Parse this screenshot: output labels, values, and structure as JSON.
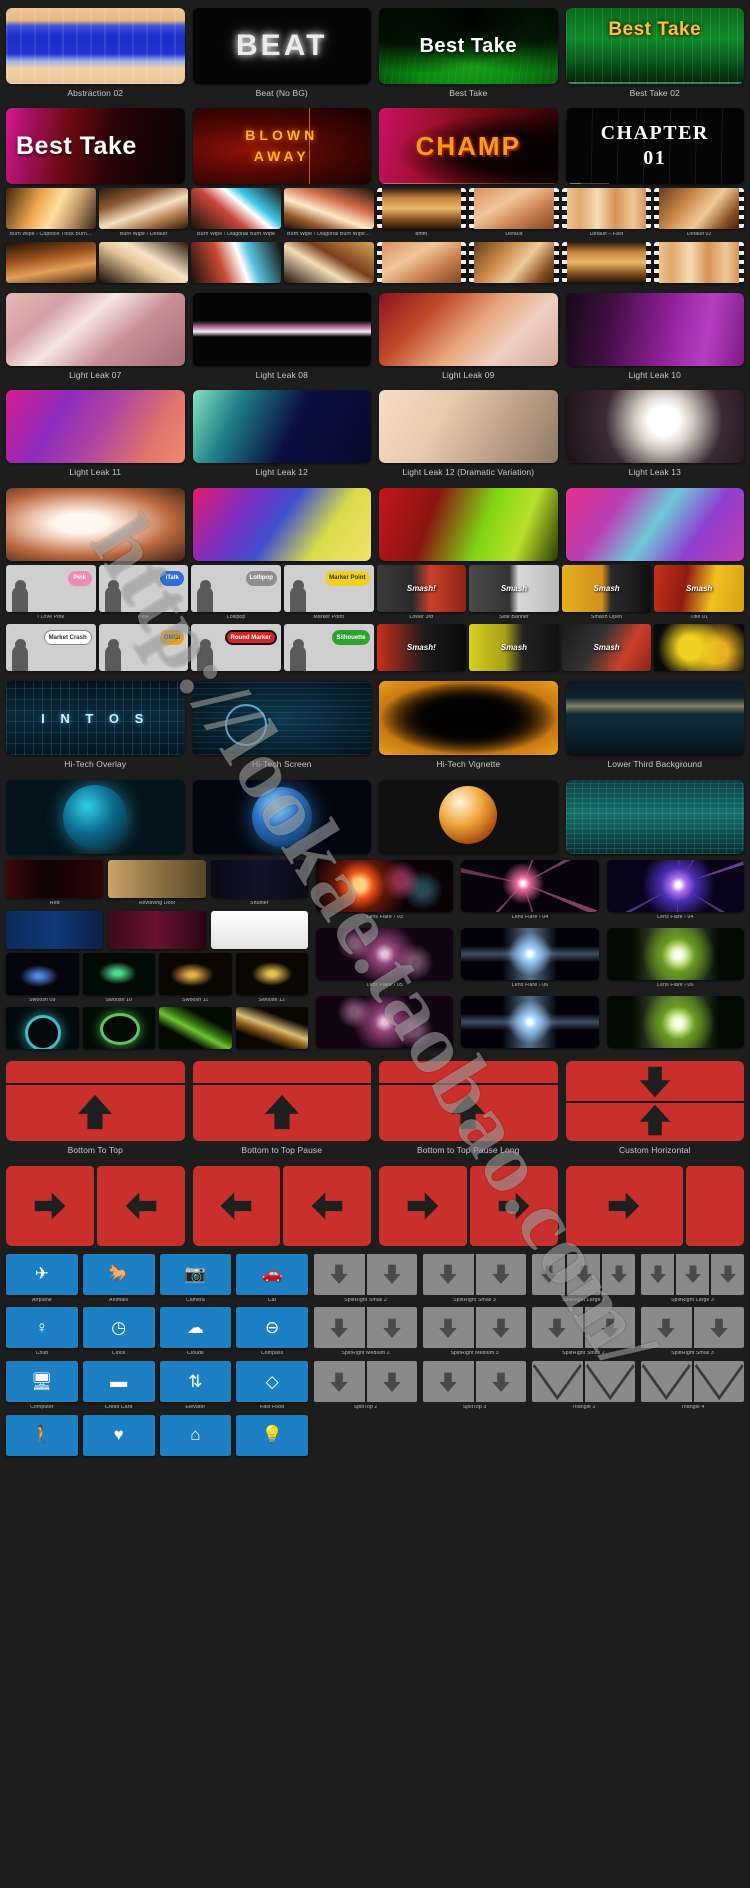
{
  "watermark": "http://lookae.taobao.com/",
  "sections": [
    {
      "id": "titles-row-1",
      "kind": "large",
      "items": [
        {
          "label": "Abstraction 02",
          "art": "abstraction02",
          "text": ""
        },
        {
          "label": "Beat (No BG)",
          "art": "beatbg",
          "text": "BEAT"
        },
        {
          "label": "Best Take",
          "art": "bestgreen",
          "text": "Best Take"
        },
        {
          "label": "Best Take 02",
          "art": "bestgreen2",
          "text": "Best Take"
        }
      ]
    },
    {
      "id": "titles-row-2",
      "kind": "large-nolabel",
      "items": [
        {
          "label": "",
          "art": "besttake1",
          "text": "Best Take"
        },
        {
          "label": "",
          "art": "blown",
          "text": "BLOWN AWAY"
        },
        {
          "label": "",
          "art": "champ",
          "text": "CHAMP"
        },
        {
          "label": "",
          "art": "chapter",
          "text": "CHAPTER 01"
        }
      ]
    },
    {
      "id": "burn-wipes-row-1",
      "kind": "small",
      "items": [
        {
          "label": "Burn Wipe › Capriole Thick Burn…",
          "art": "burn1"
        },
        {
          "label": "Burn Wipe › Default",
          "art": "burn2"
        },
        {
          "label": "Burn Wipe › Diagonal Burn Wipe",
          "art": "burn3"
        },
        {
          "label": "Burn Wipe › Diagonal Burn Wipe…",
          "art": "burn4"
        },
        {
          "label": "8mm",
          "art": "filmA",
          "perf": true
        },
        {
          "label": "Default",
          "art": "filmB",
          "perf": true
        },
        {
          "label": "Default – Fast",
          "art": "filmC",
          "perf": true
        },
        {
          "label": "Default 02",
          "art": "filmD",
          "perf": true
        }
      ]
    },
    {
      "id": "burn-wipes-row-2",
      "kind": "small-nolabel",
      "items": [
        {
          "label": "",
          "art": "burn5"
        },
        {
          "label": "",
          "art": "burn6"
        },
        {
          "label": "",
          "art": "burn7"
        },
        {
          "label": "",
          "art": "burn8"
        },
        {
          "label": "",
          "art": "filmB",
          "perf": true
        },
        {
          "label": "",
          "art": "filmD",
          "perf": true
        },
        {
          "label": "",
          "art": "filmA",
          "perf": true
        },
        {
          "label": "",
          "art": "filmC",
          "perf": true
        }
      ]
    },
    {
      "id": "light-leaks-row-1",
      "kind": "large",
      "items": [
        {
          "label": "Light Leak 07",
          "art": "ll07"
        },
        {
          "label": "Light Leak 08",
          "art": "ll08"
        },
        {
          "label": "Light Leak 09",
          "art": "ll09"
        },
        {
          "label": "Light Leak 10",
          "art": "ll10"
        }
      ]
    },
    {
      "id": "light-leaks-row-2",
      "kind": "large",
      "items": [
        {
          "label": "Light Leak 11",
          "art": "ll11"
        },
        {
          "label": "Light Leak 12",
          "art": "ll12"
        },
        {
          "label": "Light Leak 12 (Dramatic Variation)",
          "art": "ll12d"
        },
        {
          "label": "Light Leak 13",
          "art": "ll13"
        }
      ]
    },
    {
      "id": "light-leaks-row-3",
      "kind": "large-nolabel",
      "items": [
        {
          "label": "",
          "art": "ll14"
        },
        {
          "label": "",
          "art": "ll15"
        },
        {
          "label": "",
          "art": "ll16"
        },
        {
          "label": "",
          "art": "ll17"
        }
      ]
    },
    {
      "id": "lower-thirds-row-1",
      "kind": "small",
      "items": [
        {
          "label": "I Love Pink",
          "art": "silho",
          "bubble": {
            "text": "Pink",
            "style": "pink"
          }
        },
        {
          "label": "iTalk",
          "art": "silho",
          "bubble": {
            "text": "iTalk",
            "style": "blue"
          }
        },
        {
          "label": "Lollipop",
          "art": "silho",
          "bubble": {
            "text": "Lollipop",
            "style": "gray"
          }
        },
        {
          "label": "Marker Point",
          "art": "silho",
          "bubble": {
            "text": "Marker Point",
            "style": "yellow"
          }
        },
        {
          "label": "Lower 3rd",
          "art": "smash1",
          "text": "Smash!"
        },
        {
          "label": "Side Banner",
          "art": "smash2",
          "text": "Smash"
        },
        {
          "label": "Smash Open",
          "art": "smash3",
          "text": "Smash"
        },
        {
          "label": "Title 01",
          "art": "smash4",
          "text": "Smash"
        }
      ]
    },
    {
      "id": "lower-thirds-row-2",
      "kind": "small-nolabel",
      "items": [
        {
          "label": "",
          "art": "silho",
          "bubble": {
            "text": "Market Crash",
            "style": "white"
          }
        },
        {
          "label": "",
          "art": "silho",
          "bubble": {
            "text": "OMG!",
            "style": "orange"
          }
        },
        {
          "label": "",
          "art": "silho",
          "bubble": {
            "text": "Round Marker",
            "style": "red"
          }
        },
        {
          "label": "",
          "art": "silho",
          "bubble": {
            "text": "Silhouette",
            "style": "green"
          }
        },
        {
          "label": "",
          "art": "smash5",
          "text": "Smash!"
        },
        {
          "label": "",
          "art": "smash6",
          "text": "Smash"
        },
        {
          "label": "",
          "art": "smash7",
          "text": "Smash"
        },
        {
          "label": "",
          "art": "smash8",
          "text": ""
        }
      ]
    },
    {
      "id": "hi-tech-row",
      "kind": "large",
      "items": [
        {
          "label": "Hi-Tech Overlay",
          "art": "hitech1",
          "text": "I N T O S"
        },
        {
          "label": "Hi-Tech Screen",
          "art": "hitech2"
        },
        {
          "label": "Hi-Tech Vignette",
          "art": "hitech3"
        },
        {
          "label": "Lower Third Background",
          "art": "hitech4"
        }
      ]
    },
    {
      "id": "globes-row",
      "kind": "large-nolabel",
      "items": [
        {
          "label": "",
          "art": "globe1"
        },
        {
          "label": "",
          "art": "globe2"
        },
        {
          "label": "",
          "art": "globe3"
        },
        {
          "label": "",
          "art": "globe4"
        }
      ]
    },
    {
      "id": "mixed-left-lower-thirds",
      "kind": "mixed",
      "left_items": [
        {
          "label": "Red",
          "art": "lt1"
        },
        {
          "label": "Revolving Door",
          "art": "lt2"
        },
        {
          "label": "Shuffler",
          "art": "lt3"
        },
        {
          "label": "",
          "art": "lt4"
        },
        {
          "label": "",
          "art": "lt5"
        },
        {
          "label": "",
          "art": "lt6"
        }
      ],
      "right_items": [
        {
          "label": "Lens Flare › 03",
          "art": "lf1"
        },
        {
          "label": "Lens Flare › 04",
          "art": "lf2"
        },
        {
          "label": "Lens Flare › 04",
          "art": "lf3"
        },
        {
          "label": "Lens Flare › 05",
          "art": "lf4"
        },
        {
          "label": "Lens Flare › 06",
          "art": "lf5"
        },
        {
          "label": "Lens Flare › 06",
          "art": "lf6"
        }
      ]
    },
    {
      "id": "swooshes-row",
      "kind": "small",
      "items": [
        {
          "label": "Swoosh 09",
          "art": "swoosh1"
        },
        {
          "label": "Swoosh 10",
          "art": "swoosh2"
        },
        {
          "label": "Swoosh 11",
          "art": "swoosh3"
        },
        {
          "label": "Swoosh 12",
          "art": "swoosh4"
        }
      ]
    },
    {
      "id": "rings-row",
      "kind": "small-nolabel",
      "items": [
        {
          "label": "",
          "art": "ring1"
        },
        {
          "label": "",
          "art": "ring2"
        },
        {
          "label": "",
          "art": "ring3"
        },
        {
          "label": "",
          "art": "ring4"
        }
      ]
    },
    {
      "id": "red-transitions-row-1",
      "kind": "red",
      "items": [
        {
          "label": "Bottom To Top",
          "style": "single-up"
        },
        {
          "label": "Bottom to Top Pause",
          "style": "single-up"
        },
        {
          "label": "Bottom to Top Pause Long",
          "style": "single-up"
        },
        {
          "label": "Custom Horizontal",
          "style": "double-vertical"
        }
      ]
    },
    {
      "id": "red-transitions-row-2",
      "kind": "red-nolabel",
      "items": [
        {
          "label": "",
          "style": "split-right-left"
        },
        {
          "label": "",
          "style": "split-left-left"
        },
        {
          "label": "",
          "style": "split-right-right"
        },
        {
          "label": "",
          "style": "split-right-right-2"
        }
      ]
    },
    {
      "id": "blue-icons",
      "columns": 4,
      "rows": [
        [
          {
            "label": "Airplane",
            "icon": "airplane-icon",
            "glyph": "✈"
          },
          {
            "label": "Animals",
            "icon": "animals-icon",
            "glyph": "🐎"
          },
          {
            "label": "Camera",
            "icon": "camera-icon",
            "glyph": "📷"
          },
          {
            "label": "Car",
            "icon": "car-icon",
            "glyph": "🚗"
          }
        ],
        [
          {
            "label": "Child",
            "icon": "child-icon",
            "glyph": "♀"
          },
          {
            "label": "Clock",
            "icon": "clock-icon",
            "glyph": "◷"
          },
          {
            "label": "Clouds",
            "icon": "clouds-icon",
            "glyph": "☁"
          },
          {
            "label": "Compass",
            "icon": "compass-icon",
            "glyph": "⊖"
          }
        ],
        [
          {
            "label": "Computer",
            "icon": "computer-icon",
            "glyph": "🖥"
          },
          {
            "label": "Credit Card",
            "icon": "credit-card-icon",
            "glyph": "▬"
          },
          {
            "label": "Elevator",
            "icon": "elevator-icon",
            "glyph": "⇅"
          },
          {
            "label": "Fast Food",
            "icon": "fast-food-icon",
            "glyph": "◇"
          }
        ],
        [
          {
            "label": "",
            "icon": "person-icon",
            "glyph": "🚶"
          },
          {
            "label": "",
            "icon": "heart-icon",
            "glyph": "♥"
          },
          {
            "label": "",
            "icon": "home-icon",
            "glyph": "⌂"
          },
          {
            "label": "",
            "icon": "lightbulb-icon",
            "glyph": "💡"
          }
        ]
      ]
    },
    {
      "id": "spotlight-grays",
      "columns": 4,
      "rows": [
        [
          {
            "label": "SplitRight Small 2",
            "pattern": "two-down"
          },
          {
            "label": "SplitRight Small 3",
            "pattern": "two-down"
          },
          {
            "label": "SplitRight Large 2",
            "pattern": "three-down"
          },
          {
            "label": "SplitRight Large 3",
            "pattern": "three-down"
          }
        ],
        [
          {
            "label": "SplitRight Medium 2",
            "pattern": "two-down"
          },
          {
            "label": "SplitRight Medium 3",
            "pattern": "two-down"
          },
          {
            "label": "SplitRight Small 2",
            "pattern": "two-down"
          },
          {
            "label": "SplitRight Small 3",
            "pattern": "two-down"
          }
        ],
        [
          {
            "label": "SplitTop 2",
            "pattern": "two-down"
          },
          {
            "label": "SplitTop 3",
            "pattern": "two-down"
          },
          {
            "label": "Triangle 3",
            "pattern": "triangle"
          },
          {
            "label": "Triangle 4",
            "pattern": "triangle"
          }
        ]
      ]
    }
  ]
}
